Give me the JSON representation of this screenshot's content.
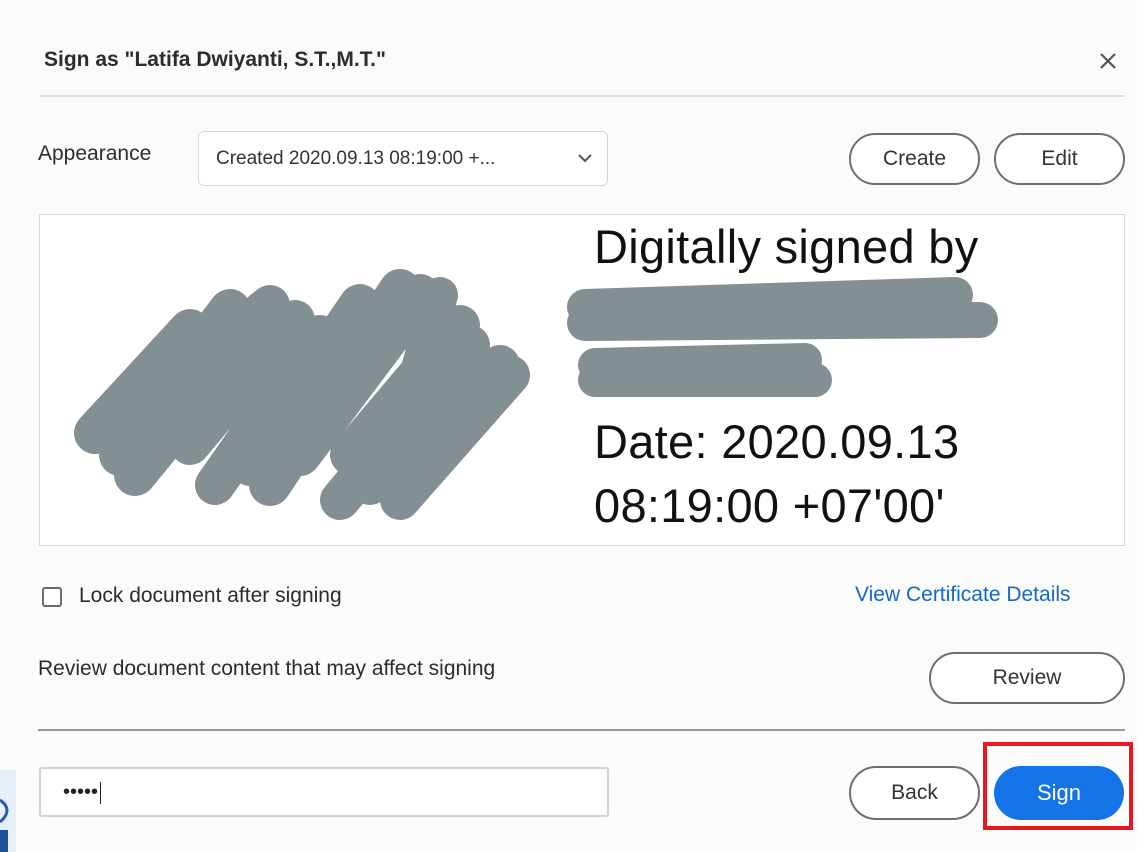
{
  "dialog": {
    "title": "Sign as \"Latifa Dwiyanti, S.T.,M.T.\"",
    "close_icon": "close-icon"
  },
  "appearance": {
    "label": "Appearance",
    "selected": "Created 2020.09.13 08:19:00 +...",
    "dropdown_icon": "chevron-down-icon",
    "create_label": "Create",
    "edit_label": "Edit"
  },
  "signature_preview": {
    "line1": "Digitally signed by",
    "date_line": "Date: 2020.09.13",
    "time_line": "08:19:00 +07'00'",
    "redaction_color": "#848f93"
  },
  "options": {
    "lock_label": "Lock document after signing",
    "lock_checked": false,
    "view_cert_link": "View Certificate Details",
    "review_text": "Review document content that may affect signing",
    "review_label": "Review"
  },
  "footer": {
    "password_value": "•••••",
    "back_label": "Back",
    "sign_label": "Sign",
    "sign_color": "#1473e6",
    "highlight_color": "#e8181f"
  }
}
